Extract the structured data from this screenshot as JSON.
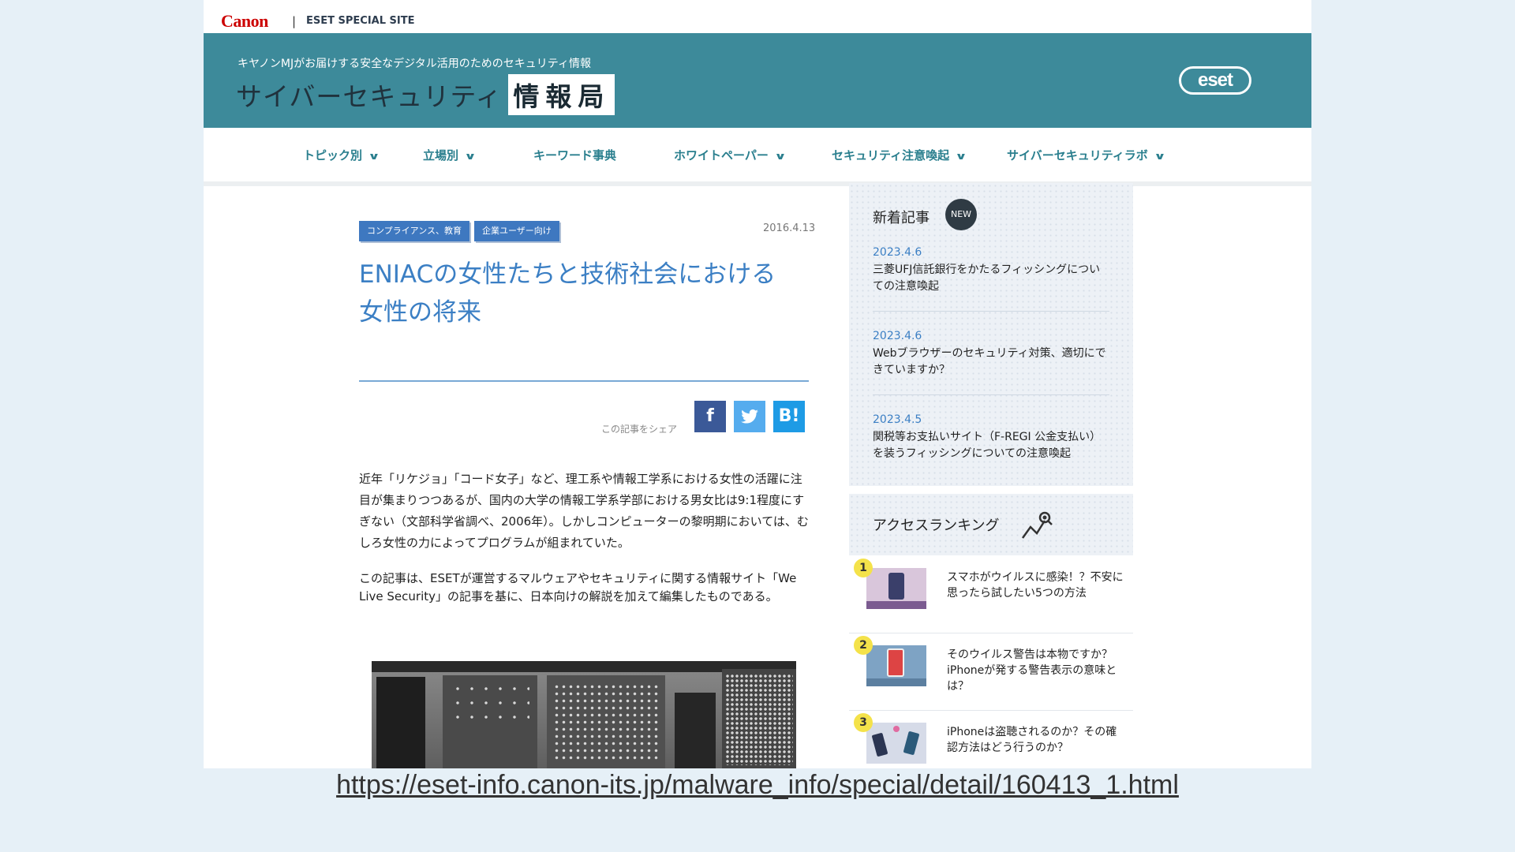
{
  "top_strip": {
    "canon_logo": "Canon",
    "separator": "|",
    "site_label": "ESET SPECIAL SITE"
  },
  "hero": {
    "subtitle": "キヤノンMJがお届けする安全なデジタル活用のためのセキュリティ情報",
    "title_main": "サイバーセキュリティ",
    "title_boxed": "情報局",
    "eset_logo": "eset"
  },
  "nav": {
    "items": [
      {
        "label": "トピック別",
        "has_dropdown": true
      },
      {
        "label": "立場別",
        "has_dropdown": true
      },
      {
        "label": "キーワード事典",
        "has_dropdown": false
      },
      {
        "label": "ホワイトペーパー",
        "has_dropdown": true
      },
      {
        "label": "セキュリティ注意喚起",
        "has_dropdown": true
      },
      {
        "label": "サイバーセキュリティラボ",
        "has_dropdown": true
      }
    ],
    "chevron": "∨"
  },
  "article": {
    "tags": [
      "コンプライアンス、教育",
      "企業ユーザー向け"
    ],
    "date": "2016.4.13",
    "title_line1": "ENIACの女性たちと技術社会における",
    "title_line2": "女性の将来",
    "share_label": "この記事をシェア",
    "share_buttons": [
      {
        "icon": "facebook-icon",
        "glyph": "f",
        "color": "#3b5998"
      },
      {
        "icon": "twitter-icon",
        "glyph": "t",
        "color": "#55acee"
      },
      {
        "icon": "hatena-bookmark-icon",
        "glyph": "B!",
        "color": "#1e9be5"
      }
    ],
    "paragraph1": "近年「リケジョ」「コード女子」など、理工系や情報工学系における女性の活躍に注目が集まりつつあるが、国内の大学の情報工学系学部における男女比は9:1程度にすぎない（文部科学省調べ、2006年）。しかしコンピューターの黎明期においては、むしろ女性の力によってプログラムが組まれていた。",
    "paragraph2": "この記事は、ESETが運営するマルウェアやセキュリティに関する情報サイト「We Live Security」の記事を基に、日本向けの解説を加えて編集したものである。"
  },
  "sidebar": {
    "new_heading": "新着記事",
    "new_badge": "NEW",
    "news": [
      {
        "date": "2023.4.6",
        "title": "三菱UFJ信託銀行をかたるフィッシングについての注意喚起"
      },
      {
        "date": "2023.4.6",
        "title": "Webブラウザーのセキュリティ対策、適切にできていますか？"
      },
      {
        "date": "2023.4.5",
        "title": "関税等お支払いサイト（F-REGI 公金支払い）を装うフィッシングについての注意喚起"
      }
    ],
    "ranking_heading": "アクセスランキング",
    "ranking_icon": "trend-search-icon",
    "ranking": [
      {
        "rank": "1",
        "title": "スマホがウイルスに感染！？不安に思ったら試したい5つの方法"
      },
      {
        "rank": "2",
        "title": "そのウイルス警告は本物ですか？iPhoneが発する警告表示の意味とは？"
      },
      {
        "rank": "3",
        "title": "iPhoneは盗聴されるのか？その確認方法はどう行うのか？"
      }
    ]
  },
  "caption_url": "https://eset-info.canon-its.jp/malware_info/special/detail/160413_1.html",
  "colors": {
    "hero_bg": "#3d8a9a",
    "nav_text": "#2a7f8e",
    "accent_blue": "#3b7fc4",
    "tag_bg": "#3e78c0"
  }
}
